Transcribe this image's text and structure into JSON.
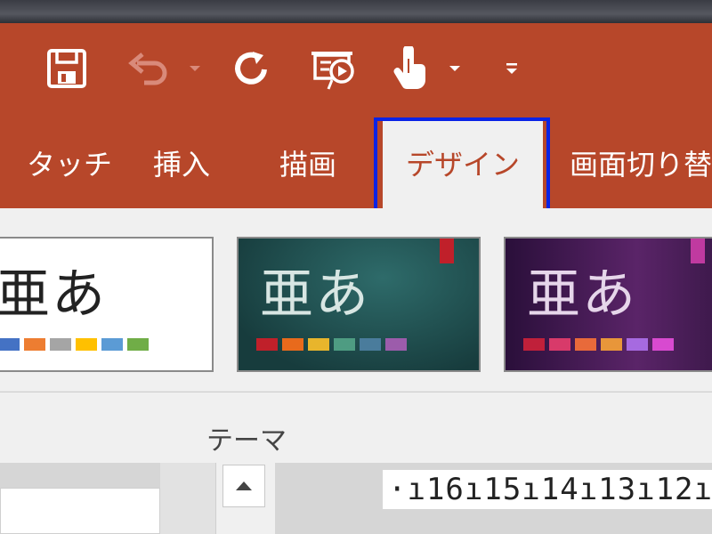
{
  "quick_access": {
    "icons": [
      "save-icon",
      "undo-icon",
      "redo-icon",
      "present-from-beginning-icon",
      "touch-mouse-mode-icon",
      "customize-qat-icon"
    ]
  },
  "tabs": [
    {
      "label": "タッチ"
    },
    {
      "label": "挿入"
    },
    {
      "label": "描画"
    },
    {
      "label": "デザイン",
      "active": true
    },
    {
      "label": "画面切り替"
    }
  ],
  "themes": [
    {
      "glyph": "亜あ",
      "bg": "#ffffff",
      "text": "#222222",
      "swatches": [
        "#4472c4",
        "#ed7d31",
        "#a5a5a5",
        "#ffc000",
        "#5b9bd5",
        "#70ad47"
      ]
    },
    {
      "glyph": "亜あ",
      "bg": "#1f4e4e",
      "text": "#d8e6e3",
      "flag": "#c0202a",
      "swatches": [
        "#c0202a",
        "#e86a1c",
        "#e8b52c",
        "#4e9c82",
        "#4a7c9c",
        "#9c5cab"
      ]
    },
    {
      "glyph": "亜あ",
      "bg": "#4a1c5a",
      "text": "#e6d6ea",
      "flag": "#c03aa0",
      "swatches": [
        "#c0203a",
        "#d83a6a",
        "#e86a3a",
        "#e8963a",
        "#a66ae0",
        "#d84ad0"
      ]
    }
  ],
  "group_label": "テーマ",
  "ruler": "·ı16ı15ı14ı13ı12ı1",
  "colors": {
    "accent": "#b7472a",
    "focus": "#0a23e6",
    "ribbon_bg": "#f0f0f0"
  }
}
